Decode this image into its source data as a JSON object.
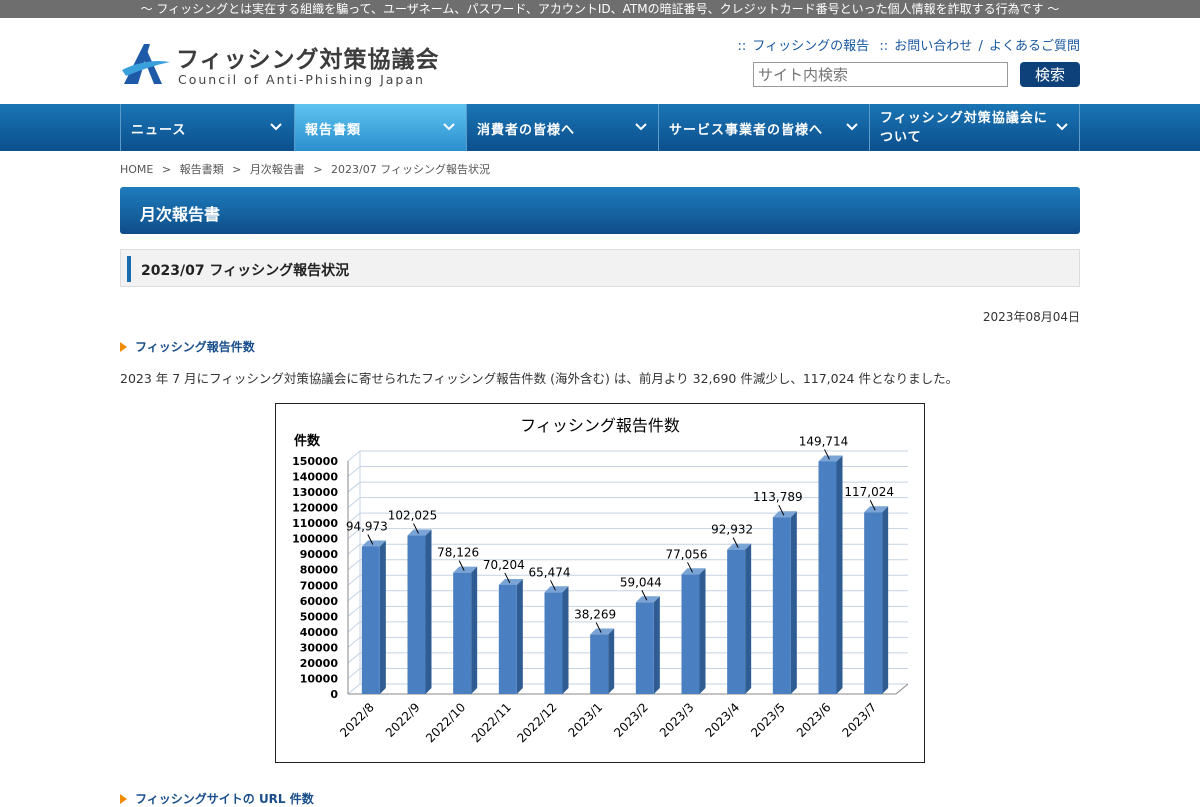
{
  "top_banner": "〜 フィッシングとは実在する組織を騙って、ユーザネーム、パスワード、アカウントID、ATMの暗証番号、クレジットカード番号といった個人情報を詐取する行為です 〜",
  "logo": {
    "title": "フィッシング対策協議会",
    "subtitle": "Council of Anti-Phishing Japan"
  },
  "header_links": {
    "report": "フィッシングの報告",
    "contact": "お問い合わせ",
    "faq": "よくあるご質問",
    "marker": "::",
    "slash": "/"
  },
  "search": {
    "placeholder": "サイト内検索",
    "button": "検索"
  },
  "nav": [
    {
      "label": "ニュース"
    },
    {
      "label": "報告書類"
    },
    {
      "label": "消費者の皆様へ"
    },
    {
      "label": "サービス事業者の皆様へ"
    },
    {
      "label": "フィッシング対策協議会について"
    }
  ],
  "breadcrumb": {
    "home": "HOME",
    "c1": "報告書類",
    "c2": "月次報告書",
    "c3": "2023/07 フィッシング報告状況",
    "sep": ">"
  },
  "page": {
    "title": "月次報告書",
    "subtitle": "2023/07 フィッシング報告状況",
    "date": "2023年08月04日",
    "section1": "フィッシング報告件数",
    "paragraph": "2023 年 7 月にフィッシング対策協議会に寄せられたフィッシング報告件数 (海外含む) は、前月より 32,690 件減少し、117,024 件となりました。",
    "section2": "フィッシングサイトの URL 件数"
  },
  "colors": {
    "nav_dark": "#0c4f8d",
    "nav_active": "#5fc4ef",
    "accent_orange": "#f08c00",
    "bar": "#4a7fc1"
  },
  "chart_data": {
    "type": "bar",
    "title": "フィッシング報告件数",
    "ylabel": "件数",
    "xlabel": "",
    "categories": [
      "2022/8",
      "2022/9",
      "2022/10",
      "2022/11",
      "2022/12",
      "2023/1",
      "2023/2",
      "2023/3",
      "2023/4",
      "2023/5",
      "2023/6",
      "2023/7"
    ],
    "values": [
      94973,
      102025,
      78126,
      70204,
      65474,
      38269,
      59044,
      77056,
      92932,
      113789,
      149714,
      117024
    ],
    "data_labels": [
      "94,973",
      "102,025",
      "78,126",
      "70,204",
      "65,474",
      "38,269",
      "59,044",
      "77,056",
      "92,932",
      "113,789",
      "149,714",
      "117,024"
    ],
    "ylim": [
      0,
      150000
    ],
    "ytick_step": 10000,
    "grid": true,
    "legend": "none",
    "style": "3d-column"
  }
}
